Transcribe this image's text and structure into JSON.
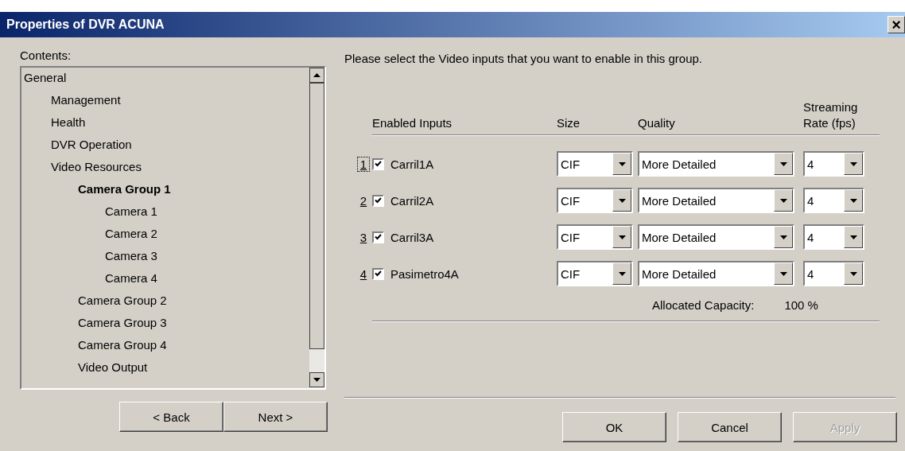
{
  "window": {
    "title": "Properties of DVR ACUNA",
    "close": "×"
  },
  "contents": {
    "label": "Contents:",
    "tree": [
      {
        "label": "General",
        "selected": false,
        "children": [
          {
            "label": "Management",
            "selected": false
          },
          {
            "label": "Health",
            "selected": false
          },
          {
            "label": "DVR Operation",
            "selected": false
          },
          {
            "label": "Video Resources",
            "selected": false,
            "children": [
              {
                "label": "Camera Group 1",
                "selected": true,
                "children": [
                  {
                    "label": "Camera 1",
                    "selected": false
                  },
                  {
                    "label": "Camera 2",
                    "selected": false
                  },
                  {
                    "label": "Camera 3",
                    "selected": false
                  },
                  {
                    "label": "Camera 4",
                    "selected": false
                  }
                ]
              },
              {
                "label": "Camera Group 2",
                "selected": false
              },
              {
                "label": "Camera Group 3",
                "selected": false
              },
              {
                "label": "Camera Group 4",
                "selected": false
              },
              {
                "label": "Video Output",
                "selected": false
              }
            ]
          }
        ]
      }
    ]
  },
  "nav_buttons": [
    "< Back",
    "Next >"
  ],
  "instruction": "Please select the Video inputs that you want to enable in this group.",
  "columns": [
    "Enabled Inputs",
    "Size",
    "Quality",
    "Streaming Rate (fps)"
  ],
  "inputs": [
    {
      "number": "1",
      "focused": true,
      "checked": true,
      "name": "Carril1A",
      "size": "CIF",
      "quality": "More Detailed",
      "rate": "4"
    },
    {
      "number": "2",
      "focused": false,
      "checked": true,
      "name": "Carril2A",
      "size": "CIF",
      "quality": "More Detailed",
      "rate": "4"
    },
    {
      "number": "3",
      "focused": false,
      "checked": true,
      "name": "Carril3A",
      "size": "CIF",
      "quality": "More Detailed",
      "rate": "4"
    },
    {
      "number": "4",
      "focused": false,
      "checked": true,
      "name": "Pasimetro4A",
      "size": "CIF",
      "quality": "More Detailed",
      "rate": "4"
    }
  ],
  "capacity": {
    "label": "Allocated Capacity:",
    "value": "100 %"
  },
  "buttons": [
    {
      "label": "OK",
      "disabled": false
    },
    {
      "label": "Cancel",
      "disabled": false
    },
    {
      "label": "Apply",
      "disabled": true
    }
  ]
}
